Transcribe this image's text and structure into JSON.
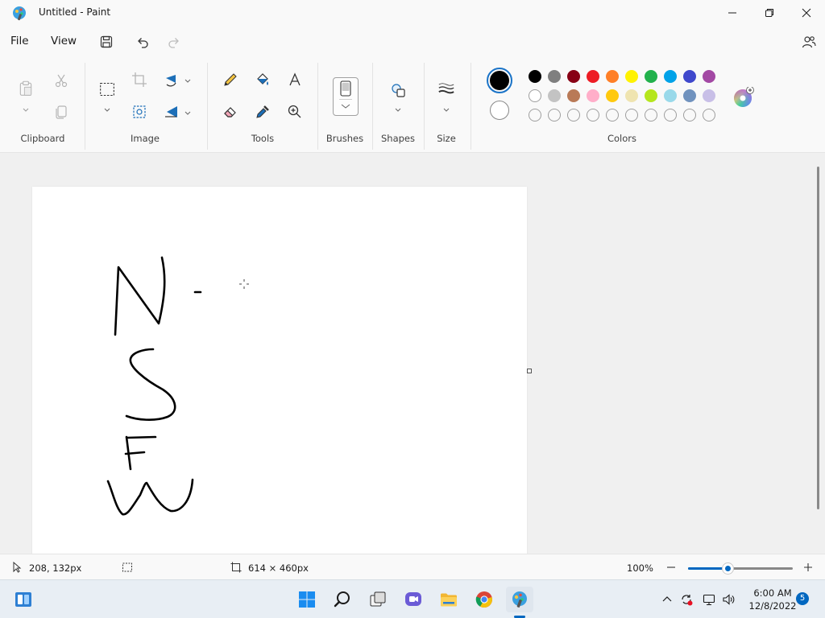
{
  "window": {
    "title": "Untitled - Paint"
  },
  "menu": {
    "file": "File",
    "view": "View"
  },
  "ribbon": {
    "groups": {
      "clipboard": "Clipboard",
      "image": "Image",
      "tools": "Tools",
      "brushes": "Brushes",
      "shapes": "Shapes",
      "size": "Size",
      "colors": "Colors"
    },
    "primary_color": "#000000",
    "secondary_color": "#ffffff",
    "palette_row1": [
      "#000000",
      "#7f7f7f",
      "#880015",
      "#ed1c24",
      "#ff7f27",
      "#fff200",
      "#22b14c",
      "#00a2e8",
      "#3f48cc",
      "#a349a4"
    ],
    "palette_row2": [
      "#ffffff",
      "#c3c3c3",
      "#b97a57",
      "#ffaec9",
      "#ffc90e",
      "#efe4b0",
      "#b5e61d",
      "#99d9ea",
      "#7092be",
      "#c8bfe7"
    ],
    "palette_row3": [
      "",
      "",
      "",
      "",
      "",
      "",
      "",
      "",
      "",
      ""
    ]
  },
  "canvas": {
    "drawn_text_strokes": "N - S F W"
  },
  "statusbar": {
    "cursor_position": "208, 132px",
    "canvas_size": "614 × 460px",
    "zoom": "100%",
    "zoom_level_fraction": 0.38
  },
  "taskbar": {
    "apps": [
      "start-icon",
      "search-icon",
      "task-view-icon",
      "chat-icon",
      "file-explorer-icon",
      "chrome-icon",
      "paint-icon"
    ],
    "time": "6:00 AM",
    "date": "12/8/2022",
    "notification_count": "5"
  }
}
